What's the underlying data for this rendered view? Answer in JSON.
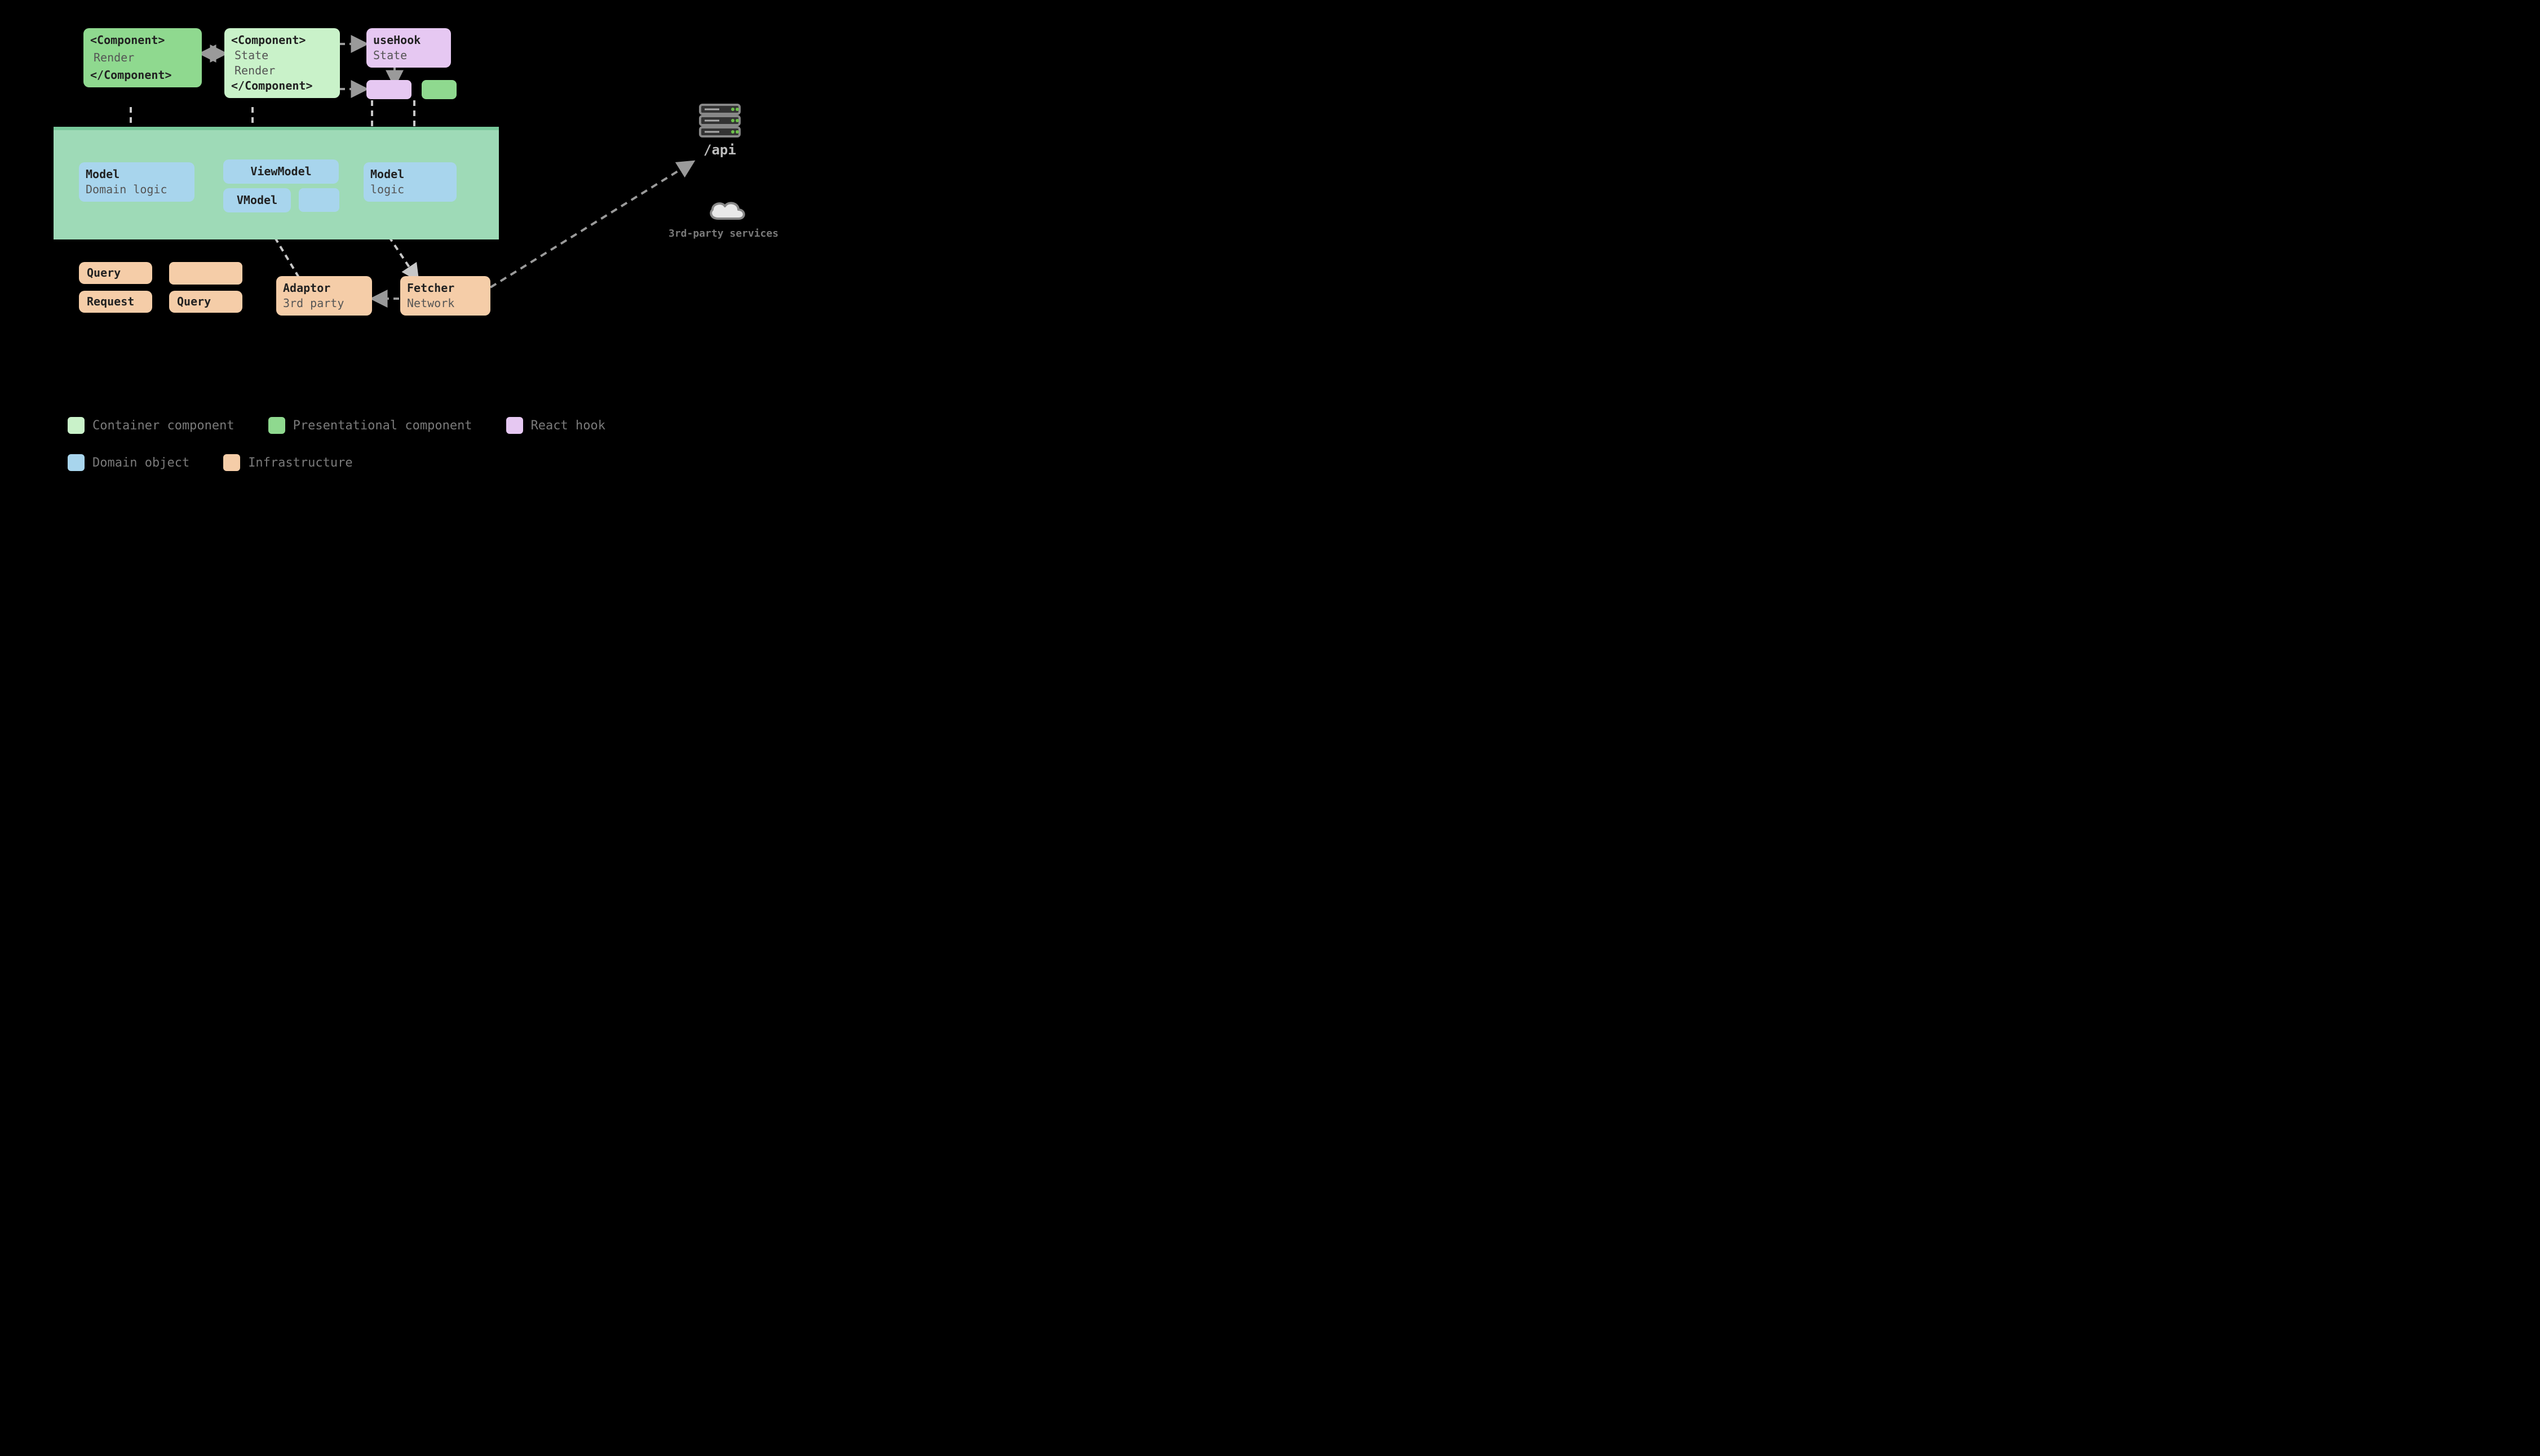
{
  "nodes": {
    "presentational_component": {
      "tag_open": "<Component>",
      "body": "Render",
      "tag_close": "</Component>"
    },
    "container_component": {
      "tag_open": "<Component>",
      "body1": "State",
      "body2": "Render",
      "tag_close": "</Component>"
    },
    "hook": {
      "title": "useHook",
      "sub": "State"
    },
    "model_a": {
      "title": "Model",
      "sub": "Domain logic"
    },
    "viewmodel": {
      "title": "ViewModel"
    },
    "vmodel": {
      "title": "VModel"
    },
    "model_b": {
      "title": "Model",
      "sub": "logic"
    },
    "query_a": {
      "title": "Query"
    },
    "request": {
      "title": "Request"
    },
    "query_b": {
      "title": "Query"
    },
    "adaptor": {
      "title": "Adaptor",
      "sub": "3rd party"
    },
    "fetcher": {
      "title": "Fetcher",
      "sub": "Network"
    }
  },
  "external": {
    "api_label": "/api",
    "third_party_label": "3rd-party services"
  },
  "legend": {
    "container": "Container component",
    "presentational": "Presentational component",
    "react_hook": "React hook",
    "domain_object": "Domain object",
    "infrastructure": "Infrastructure"
  },
  "colors": {
    "container_component": "#c9f2c9",
    "presentational_component": "#8fd98f",
    "react_hook": "#e6c8f2",
    "domain_object": "#a8d5ed",
    "infrastructure": "#f5cda8",
    "domain_panel": "#9edab7",
    "arrow": "#9a9a9a"
  }
}
